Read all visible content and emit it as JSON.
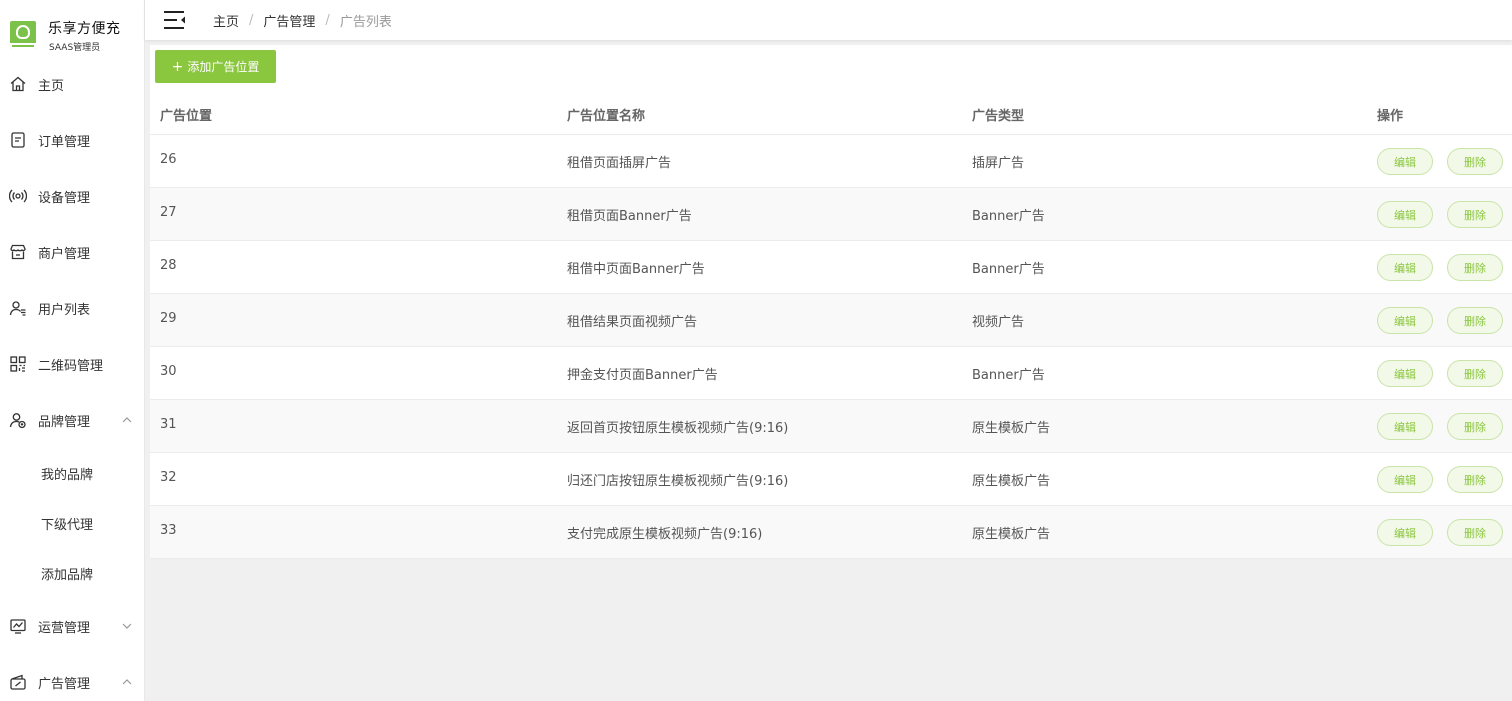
{
  "brand": {
    "name": "乐享方便充",
    "role": "SAAS管理员"
  },
  "sidebar": {
    "items": [
      {
        "label": "主页",
        "icon": "home-icon"
      },
      {
        "label": "订单管理",
        "icon": "order-icon"
      },
      {
        "label": "设备管理",
        "icon": "device-icon"
      },
      {
        "label": "商户管理",
        "icon": "store-icon"
      },
      {
        "label": "用户列表",
        "icon": "user-list-icon"
      },
      {
        "label": "二维码管理",
        "icon": "qrcode-icon"
      },
      {
        "label": "品牌管理",
        "icon": "brand-icon",
        "expanded": true
      },
      {
        "label": "运营管理",
        "icon": "chart-icon",
        "expanded": false
      },
      {
        "label": "广告管理",
        "icon": "ad-icon",
        "expanded": true
      }
    ],
    "brand_sub": [
      "我的品牌",
      "下级代理",
      "添加品牌"
    ]
  },
  "breadcrumb": [
    "主页",
    "广告管理",
    "广告列表"
  ],
  "toolbar": {
    "add_label": "添加广告位置"
  },
  "table": {
    "headers": [
      "广告位置",
      "广告位置名称",
      "广告类型",
      "操作"
    ],
    "rows": [
      {
        "id": "26",
        "name": "租借页面插屏广告",
        "type": "插屏广告"
      },
      {
        "id": "27",
        "name": "租借页面Banner广告",
        "type": "Banner广告"
      },
      {
        "id": "28",
        "name": "租借中页面Banner广告",
        "type": "Banner广告"
      },
      {
        "id": "29",
        "name": "租借结果页面视频广告",
        "type": "视频广告"
      },
      {
        "id": "30",
        "name": "押金支付页面Banner广告",
        "type": "Banner广告"
      },
      {
        "id": "31",
        "name": "返回首页按钮原生模板视频广告(9:16)",
        "type": "原生模板广告"
      },
      {
        "id": "32",
        "name": "归还门店按钮原生模板视频广告(9:16)",
        "type": "原生模板广告"
      },
      {
        "id": "33",
        "name": "支付完成原生模板视频广告(9:16)",
        "type": "原生模板广告"
      }
    ],
    "edit_label": "编辑",
    "delete_label": "删除"
  },
  "colors": {
    "accent": "#8bc63f",
    "accent_light": "#f2f9e8"
  }
}
